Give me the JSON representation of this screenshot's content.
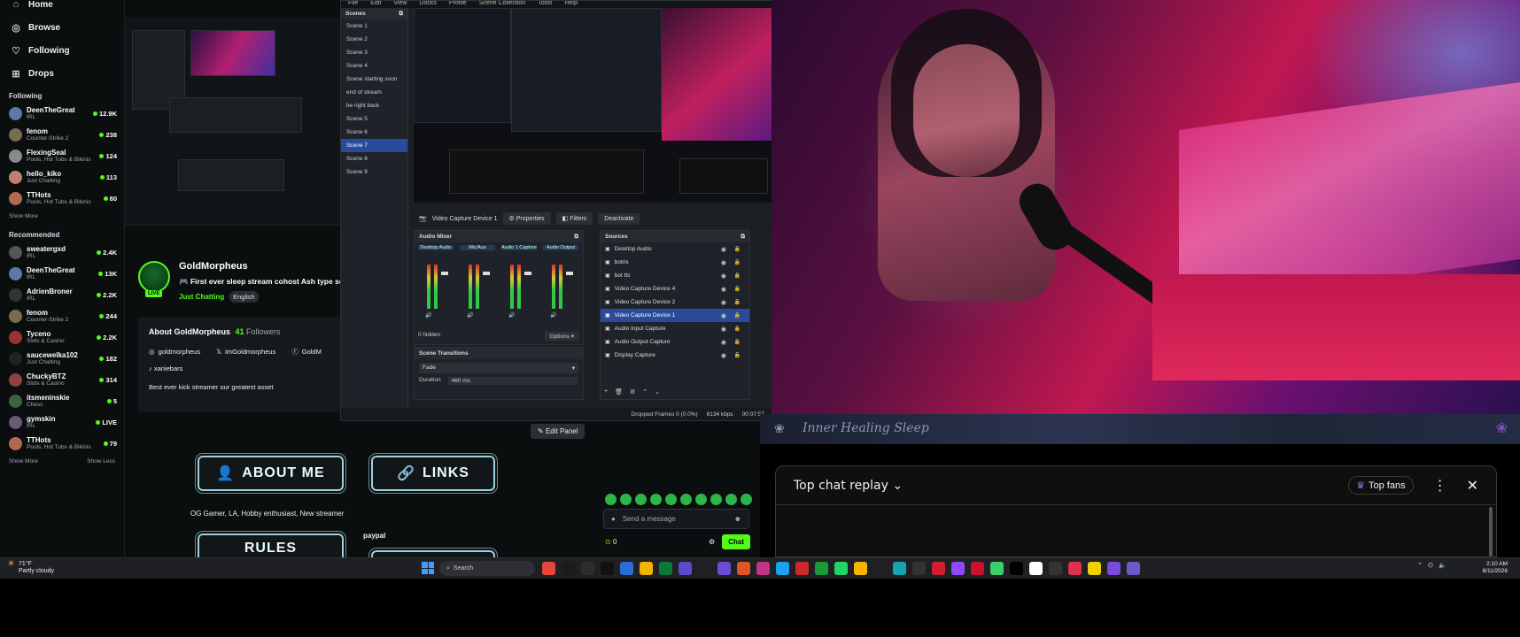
{
  "sidebar": {
    "nav": [
      {
        "label": "Home",
        "icon": "home-icon",
        "glyph": "⌂"
      },
      {
        "label": "Browse",
        "icon": "browse-icon",
        "glyph": "◎"
      },
      {
        "label": "Following",
        "icon": "heart-icon",
        "glyph": "♡"
      },
      {
        "label": "Drops",
        "icon": "gift-icon",
        "glyph": "⊞"
      }
    ],
    "following_title": "Following",
    "following": [
      {
        "name": "DeenTheGreat",
        "category": "IRL",
        "viewers": "12.9K",
        "color": "#5a7aa8"
      },
      {
        "name": "fenom",
        "category": "Counter-Strike 2",
        "viewers": "238",
        "color": "#7a6a50"
      },
      {
        "name": "FlexingSeal",
        "category": "Pools, Hot Tubs & Bikinis",
        "viewers": "124",
        "color": "#8a8a8a"
      },
      {
        "name": "hello_kiko",
        "category": "Just Chatting",
        "viewers": "113",
        "color": "#c08070"
      },
      {
        "name": "TTHots",
        "category": "Pools, Hot Tubs & Bikinis",
        "viewers": "80",
        "color": "#b06a50"
      }
    ],
    "show_more": "Show More",
    "recommended_title": "Recommended",
    "recommended": [
      {
        "name": "sweatergxd",
        "category": "IRL",
        "viewers": "2.4K",
        "color": "#555"
      },
      {
        "name": "DeenTheGreat",
        "category": "IRL",
        "viewers": "13K",
        "color": "#5a7aa8"
      },
      {
        "name": "AdrienBroner",
        "category": "IRL",
        "viewers": "2.2K",
        "color": "#333"
      },
      {
        "name": "fenom",
        "category": "Counter-Strike 2",
        "viewers": "244",
        "color": "#7a6a50"
      },
      {
        "name": "Tyceno",
        "category": "Slots & Casino",
        "viewers": "2.2K",
        "color": "#a03030"
      },
      {
        "name": "saucewelka102",
        "category": "Just Chatting",
        "viewers": "182",
        "color": "#222"
      },
      {
        "name": "ChuckyBTZ",
        "category": "Slots & Casino",
        "viewers": "314",
        "color": "#904040"
      },
      {
        "name": "itsmeninskie",
        "category": "Chess",
        "viewers": "5",
        "color": "#406040"
      },
      {
        "name": "gymskin",
        "category": "IRL",
        "viewers": "LIVE",
        "color": "#6a5a7a"
      },
      {
        "name": "TTHots",
        "category": "Pools, Hot Tubs & Bikinis",
        "viewers": "79",
        "color": "#b06a50"
      }
    ],
    "show_less": "Show Less"
  },
  "stream": {
    "name": "GoldMorpheus",
    "title": "🎮 First ever sleep stream cohost Ash type som",
    "category": "Just Chatting",
    "language": "English",
    "live": "LIVE"
  },
  "about": {
    "title": "About GoldMorpheus",
    "followers": "41",
    "followers_label": "Followers",
    "instagram": "goldmorpheus",
    "x": "imGoldmorpheus",
    "facebook": "GoldM",
    "tiktok": "xaniebars",
    "bio": "Best ever kick streamer our greatest asset"
  },
  "panels": {
    "about_me": "ABOUT ME",
    "links": "LINKS",
    "rules": "RULES",
    "caption": "OG Gamer, LA, Hobby enthusiast, New streamer",
    "paypal": "paypal",
    "edit_panel": "Edit Panel"
  },
  "kick_chat": {
    "placeholder": "Send a message",
    "points": "0",
    "chat_button": "Chat"
  },
  "obs": {
    "menu": [
      "File",
      "Edit",
      "View",
      "Docks",
      "Profile",
      "Scene Collection",
      "Tools",
      "Help"
    ],
    "scenes_title": "Scenes",
    "scenes": [
      "Scene 1",
      "Scene 2",
      "Scene 3",
      "Scene 4",
      "Scene starting soon",
      "end of stream",
      "be right back",
      "Scene 5",
      "Scene 6",
      "Scene 7",
      "Scene 8",
      "Scene 9"
    ],
    "selected_scene": "Scene 7",
    "source_label": "Video Capture Device 1",
    "properties": "Properties",
    "filters": "Filters",
    "deactivate": "Deactivate",
    "audio_mixer_title": "Audio Mixer",
    "mixer_channels": [
      "Desktop Audio",
      "Mic/Aux",
      "Audio 1 Capture",
      "Audio Output"
    ],
    "hidden": "0 hidden",
    "options": "Options",
    "sources_title": "Sources",
    "sources": [
      "Desktop Audio",
      "botrix",
      "bot tts",
      "Video Capture Device 4",
      "Video Capture Device 2",
      "Video Capture Device 1",
      "Audio Input Capture",
      "Audio Output Capture",
      "Display Capture"
    ],
    "selected_source": "Video Capture Device 1",
    "transitions_title": "Scene Transitions",
    "transition": "Fade",
    "duration_label": "Duration",
    "duration_value": "460 ms",
    "status_dropped": "Dropped Frames 0 (0.0%)",
    "status_kbps": "6134 kbps",
    "status_time": "00:07:57"
  },
  "youtube": {
    "banner": "Inner Healing Sleep",
    "chat_mode": "Top chat replay",
    "top_fans": "Top fans"
  },
  "taskbar": {
    "temp": "71°F",
    "weather": "Partly cloudy",
    "search": "Search",
    "time": "2:10 AM",
    "date": "8/11/2026",
    "app_colors": [
      "#e8453c",
      "#1c1c1c",
      "#2d2d2d",
      "#111",
      "#2b6cd6",
      "#f0b400",
      "#0a7a3a",
      "#5a4acd",
      "#222",
      "#6b4ad6",
      "#e0542a",
      "#c13584",
      "#1ea0f0",
      "#cc2a2a",
      "#1b9a3c",
      "#25d366",
      "#f4b400",
      "#222",
      "#18a3b3",
      "#333",
      "#d02030",
      "#9146ff",
      "#cc1030",
      "#3ad16a",
      "#000",
      "#fff",
      "#333",
      "#e03050",
      "#f0d000",
      "#7a4ae0",
      "#6a5acd"
    ]
  }
}
